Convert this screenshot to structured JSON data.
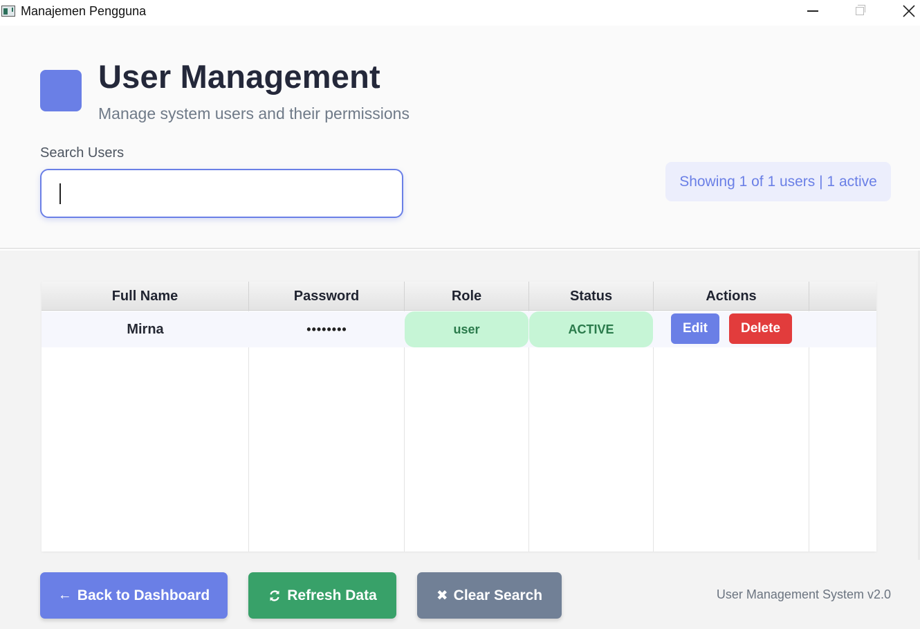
{
  "window": {
    "title": "Manajemen Pengguna"
  },
  "header": {
    "title": "User Management",
    "subtitle": "Manage system users and their permissions",
    "search_label": "Search Users",
    "search_value": "",
    "count_text": "Showing 1 of 1 users | 1 active"
  },
  "colors": {
    "accent": "#6a7fe6",
    "success": "#38a169",
    "danger": "#e23c3c",
    "neutral": "#718096"
  },
  "table": {
    "columns": [
      "Full Name",
      "Password",
      "Role",
      "Status",
      "Actions"
    ],
    "rows": [
      {
        "full_name": "Mirna",
        "password": "••••••••",
        "role": "user",
        "status": "ACTIVE",
        "edit_label": "Edit",
        "delete_label": "Delete"
      }
    ]
  },
  "footer": {
    "back_label": "Back to Dashboard",
    "back_icon": "arrow-left-icon",
    "refresh_label": "Refresh Data",
    "refresh_icon": "refresh-icon",
    "clear_label": "Clear Search",
    "clear_icon": "close-icon",
    "version": "User Management System v2.0"
  }
}
